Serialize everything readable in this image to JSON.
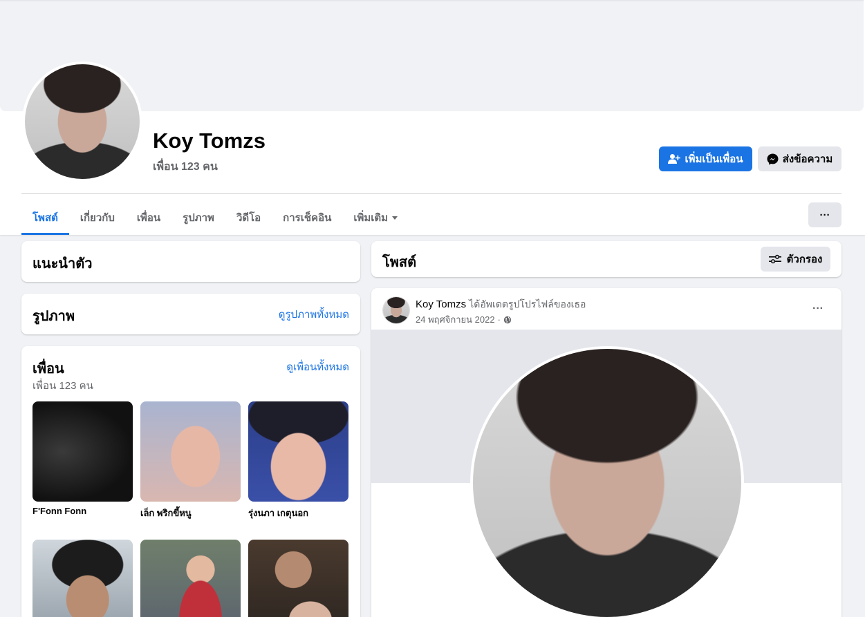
{
  "profile": {
    "name": "Koy Tomzs",
    "friends_count": "เพื่อน 123 คน"
  },
  "actions": {
    "add_friend": "เพิ่มเป็นเพื่อน",
    "message": "ส่งข้อความ",
    "more": "···"
  },
  "tabs": [
    {
      "label": "โพสต์",
      "active": true
    },
    {
      "label": "เกี่ยวกับ",
      "active": false
    },
    {
      "label": "เพื่อน",
      "active": false
    },
    {
      "label": "รูปภาพ",
      "active": false
    },
    {
      "label": "วิดีโอ",
      "active": false
    },
    {
      "label": "การเช็คอิน",
      "active": false
    },
    {
      "label": "เพิ่มเติม",
      "active": false
    }
  ],
  "intro": {
    "title": "แนะนำตัว"
  },
  "photos": {
    "title": "รูปภาพ",
    "see_all": "ดูรูปภาพทั้งหมด"
  },
  "friends": {
    "title": "เพื่อน",
    "count": "เพื่อน 123 คน",
    "see_all": "ดูเพื่อนทั้งหมด",
    "items": [
      {
        "name": "F'Fonn Fonn"
      },
      {
        "name": "เล็ก พริกขี้หนู"
      },
      {
        "name": "รุ่งนภา เกตุนอก"
      },
      {
        "name": ""
      },
      {
        "name": ""
      },
      {
        "name": ""
      }
    ]
  },
  "posts_header": {
    "title": "โพสต์",
    "filter": "ตัวกรอง"
  },
  "post": {
    "author": "Koy Tomzs",
    "action": "ได้อัพเดตรูปโปรไฟล์ของเธอ",
    "date": "24 พฤศจิกายน 2022",
    "separator": "·",
    "more": "···"
  },
  "colors": {
    "accent": "#1b74e4",
    "secondary_button": "#e4e6eb",
    "page_bg": "#f0f2f5",
    "muted_text": "#65676b"
  }
}
